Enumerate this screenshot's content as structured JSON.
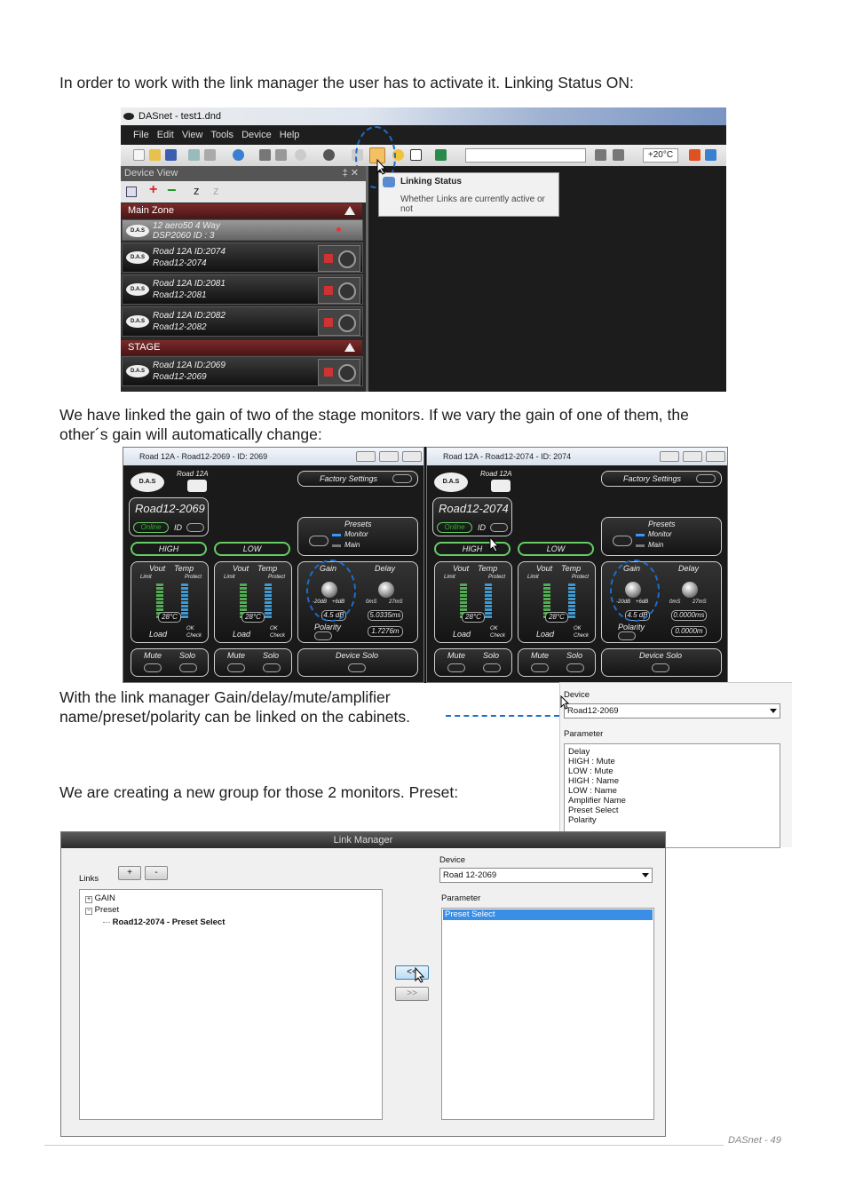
{
  "text": {
    "p1": "In order to work with the link manager the user has to activate it. Linking Status ON:",
    "p2_line1": "We have linked the gain of two of the stage monitors. If we vary the gain of one of them, the",
    "p2_line2": "other´s gain will automatically change:",
    "p3_line1": "With the link manager Gain/delay/mute/amplifier",
    "p3_line2": "name/preset/polarity can be linked on the cabinets.",
    "p4": "We are creating a new group for those 2 monitors. Preset:",
    "footer": "DASnet  - 49"
  },
  "shot1": {
    "title": "DASnet - test1.dnd",
    "menu": [
      "File",
      "Edit",
      "View",
      "Tools",
      "Device",
      "Help"
    ],
    "temp": "+20°C",
    "device_view": "Device View",
    "device_view_pin": "‡ ✕",
    "tooltip_title": "Linking Status",
    "tooltip_text1": "Whether Links are currently active or",
    "tooltip_text2": "not",
    "zone1": "Main Zone",
    "zone2": "STAGE",
    "logo": "D.A.S",
    "dev0_l1": "12 aero50 4 Way",
    "dev0_l2": "DSP2060  ID : 3",
    "dev1_l1": "Road 12A  ID:2074",
    "dev1_l2": "Road12-2074",
    "dev2_l1": "Road 12A  ID:2081",
    "dev2_l2": "Road12-2081",
    "dev3_l1": "Road 12A  ID:2082",
    "dev3_l2": "Road12-2082",
    "dev4_l1": "Road 12A  ID:2069",
    "dev4_l2": "Road12-2069"
  },
  "shot2": {
    "w1_title": "Road 12A - Road12-2069 - ID: 2069",
    "w2_title": "Road 12A - Road12-2074 - ID: 2074",
    "model": "Road 12A",
    "logo": "D.A.S",
    "w1_name": "Road12-2069",
    "w2_name": "Road12-2074",
    "online": "Online",
    "id": "ID",
    "factory": "Factory Settings",
    "presets": "Presets",
    "monitor": "Monitor",
    "main": "Main",
    "high": "HIGH",
    "low": "LOW",
    "vout": "Vout",
    "temp": "Temp",
    "limit": "Limit",
    "protect": "Protect",
    "temp_val": "28°C",
    "load": "Load",
    "ok": "OK",
    "check": "Check",
    "gain": "Gain",
    "delay": "Delay",
    "gain_min": "-20dB",
    "gain_max": "+6dB",
    "delay_min": "0mS",
    "delay_max": "27mS",
    "w1_gain": "4.5 dB",
    "w1_delay_ms": "5.0335ms",
    "w1_delay_m": "1.7276m",
    "w2_gain": "4.5 dB",
    "w2_delay_ms": "0.0000ms",
    "w2_delay_m": "0.0000m",
    "polarity": "Polarity",
    "mute": "Mute",
    "solo": "Solo",
    "device_solo": "Device Solo"
  },
  "shot3": {
    "device_label": "Device",
    "device_value": "Road12-2069",
    "parameter_label": "Parameter",
    "parameters": [
      "Delay",
      "HIGH : Mute",
      "LOW : Mute",
      "HIGH : Name",
      "LOW : Name",
      "Amplifier Name",
      "Preset Select",
      "Polarity"
    ]
  },
  "shot4": {
    "title": "Link Manager",
    "links_label": "Links",
    "plus": "+",
    "minus": "-",
    "tree_gain": "GAIN",
    "tree_preset": "Preset",
    "tree_child": "Road12-2074 - Preset Select",
    "device_label": "Device",
    "device_value": "Road 12-2069",
    "parameter_label": "Parameter",
    "parameter_selected": "Preset Select",
    "btn_left": "<<",
    "btn_right": ">>"
  }
}
